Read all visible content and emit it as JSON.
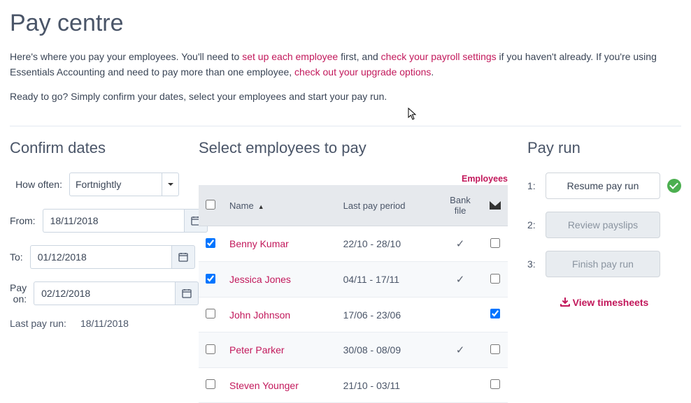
{
  "header": {
    "title": "Pay centre",
    "intro_a": "Here's where you pay your employees. You'll need to ",
    "link1": "set up each employee",
    "intro_b": " first, and ",
    "link2": "check your payroll settings",
    "intro_c": " if you haven't already. If you're using Essentials Accounting and need to pay more than one employee, ",
    "link3": "check out your upgrade options",
    "intro_d": ".",
    "ready": "Ready to go? Simply confirm your dates, select your employees and start your pay run."
  },
  "confirm": {
    "heading": "Confirm dates",
    "how_often_label": "How often:",
    "how_often_value": "Fortnightly",
    "from_label": "From:",
    "from_value": "18/11/2018",
    "to_label": "To:",
    "to_value": "01/12/2018",
    "pay_on_label": "Pay on:",
    "pay_on_value": "02/12/2018",
    "last_run_label": "Last pay run:",
    "last_run_value": "18/11/2018"
  },
  "select": {
    "heading": "Select employees to pay",
    "employees_link": "Employees",
    "col_name": "Name",
    "col_period": "Last pay period",
    "col_bank": "Bank file",
    "rows": [
      {
        "name": "Benny Kumar",
        "period": "22/10 - 28/10",
        "bank": "✓",
        "email": "",
        "checked": "☑"
      },
      {
        "name": "Jessica Jones",
        "period": "04/11 - 17/11",
        "bank": "✓",
        "email": "",
        "checked": "☑"
      },
      {
        "name": "John Johnson",
        "period": "17/06 - 23/06",
        "bank": "",
        "email": "☑",
        "checked": ""
      },
      {
        "name": "Peter Parker",
        "period": "30/08 - 08/09",
        "bank": "✓",
        "email": "",
        "checked": ""
      },
      {
        "name": "Steven Younger",
        "period": "21/10 - 03/11",
        "bank": "",
        "email": "",
        "checked": ""
      }
    ]
  },
  "payrun": {
    "heading": "Pay run",
    "step1": "1:",
    "btn1": "Resume pay run",
    "step2": "2:",
    "btn2": "Review payslips",
    "step3": "3:",
    "btn3": "Finish pay run",
    "view_ts": "View timesheets"
  }
}
